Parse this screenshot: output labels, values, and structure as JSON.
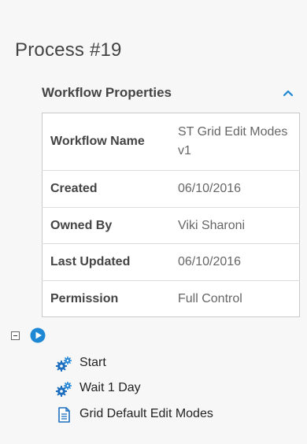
{
  "page": {
    "title": "Process #19"
  },
  "section": {
    "title": "Workflow Properties",
    "collapse_icon": "chevron-up-icon"
  },
  "properties": [
    {
      "key": "Workflow Name",
      "value": "ST Grid Edit Modes v1"
    },
    {
      "key": "Created",
      "value": "06/10/2016"
    },
    {
      "key": "Owned By",
      "value": "Viki Sharoni"
    },
    {
      "key": "Last Updated",
      "value": "06/10/2016"
    },
    {
      "key": "Permission",
      "value": "Full Control"
    }
  ],
  "tree": {
    "root_icons": [
      "collapse-box-icon",
      "play-circle-icon"
    ],
    "items": [
      {
        "label": "Start",
        "icon": "gears-icon"
      },
      {
        "label": "Wait 1 Day",
        "icon": "gears-icon"
      },
      {
        "label": "Grid Default Edit Modes",
        "icon": "document-icon"
      }
    ]
  },
  "colors": {
    "accent": "#1e88d4",
    "background": "#f7f7f7",
    "table_border": "#c8c8c8"
  }
}
